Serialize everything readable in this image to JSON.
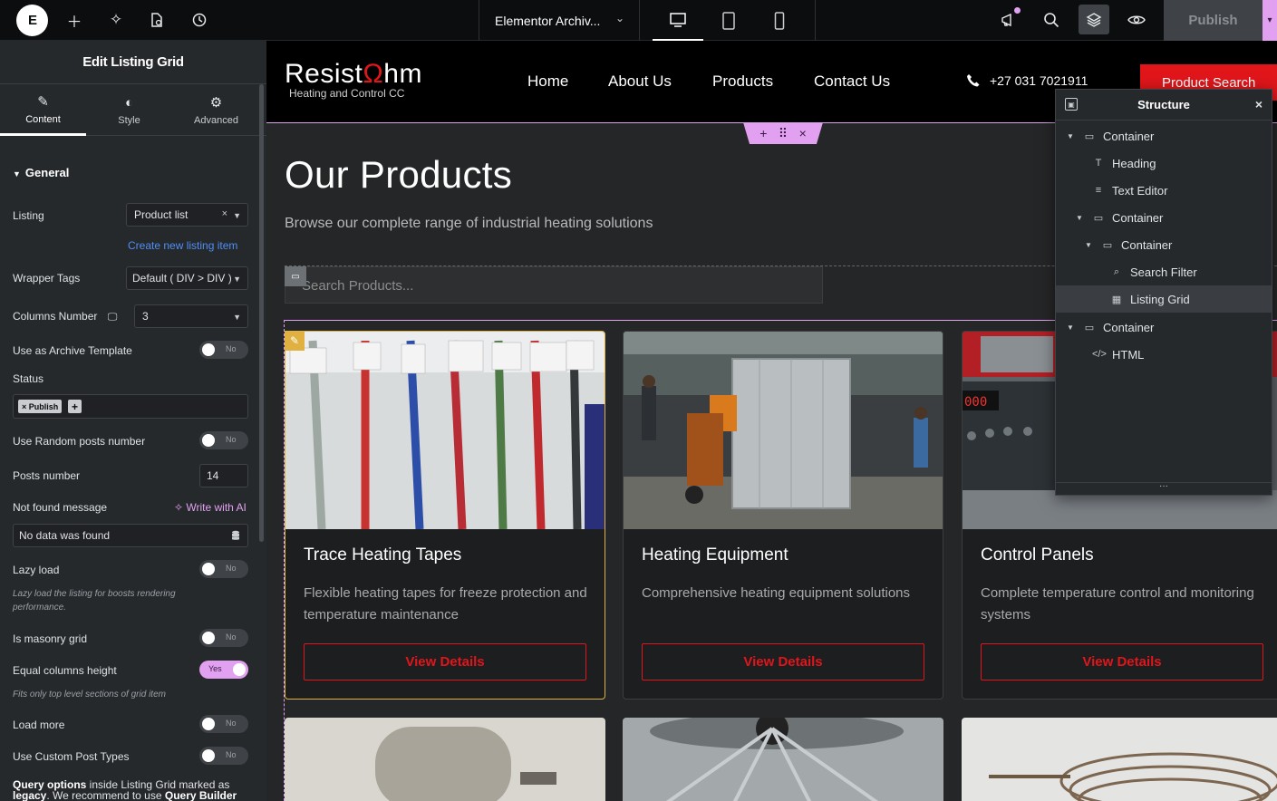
{
  "topbar": {
    "logo": "E",
    "document_title": "Elementor Archiv...",
    "publish_label": "Publish"
  },
  "panel": {
    "title": "Edit Listing Grid",
    "tabs": [
      {
        "label": "Content",
        "icon": "pencil-icon"
      },
      {
        "label": "Style",
        "icon": "half-circle-icon"
      },
      {
        "label": "Advanced",
        "icon": "gear-icon"
      }
    ],
    "section": "General",
    "listing_label": "Listing",
    "listing_value": "Product list",
    "create_link": "Create new listing item",
    "wrapper_label": "Wrapper Tags",
    "wrapper_value": "Default ( DIV > DIV )",
    "columns_label": "Columns Number",
    "columns_value": "3",
    "archive_label": "Use as Archive Template",
    "archive_value": "No",
    "status_label": "Status",
    "status_chip": "× Publish",
    "status_add": "+",
    "random_label": "Use Random posts number",
    "random_value": "No",
    "posts_label": "Posts number",
    "posts_value": "14",
    "notfound_label": "Not found message",
    "write_ai": "Write with AI",
    "notfound_value": "No data was found",
    "lazy_label": "Lazy load",
    "lazy_value": "No",
    "lazy_hint": "Lazy load the listing for boosts rendering performance.",
    "masonry_label": "Is masonry grid",
    "masonry_value": "No",
    "equal_label": "Equal columns height",
    "equal_value": "Yes",
    "equal_hint": "Fits only top level sections of grid item",
    "loadmore_label": "Load more",
    "loadmore_value": "No",
    "custom_label": "Use Custom Post Types",
    "custom_value": "No",
    "legacy_b1": "Query options",
    "legacy_t1": " inside Listing Grid marked as ",
    "legacy_b2": "legacy",
    "legacy_t2": ". We recommend to use ",
    "legacy_b3": "Query Builder"
  },
  "site": {
    "brand_main_a": "Resist",
    "brand_main_om": "Ω",
    "brand_main_b": "hm",
    "brand_sub": "Heating and Control CC",
    "nav": [
      "Home",
      "About Us",
      "Products",
      "Contact Us"
    ],
    "phone": "+27 031 7021911",
    "search_button": "Product Search",
    "heading": "Our Products",
    "subheading": "Browse our complete range of industrial heating solutions",
    "search_placeholder": "Search Products...",
    "cards": [
      {
        "title": "Trace Heating Tapes",
        "desc": "Flexible heating tapes for freeze protection and temperature maintenance",
        "button": "View Details"
      },
      {
        "title": "Heating Equipment",
        "desc": "Comprehensive heating equipment solutions",
        "button": "View Details"
      },
      {
        "title": "Control Panels",
        "desc": "Complete temperature control and monitoring systems",
        "button": "View Details"
      }
    ]
  },
  "structure": {
    "title": "Structure",
    "rows": [
      {
        "label": "Container",
        "icon": "container-icon"
      },
      {
        "label": "Heading",
        "icon": "heading-icon"
      },
      {
        "label": "Text Editor",
        "icon": "text-editor-icon"
      },
      {
        "label": "Container",
        "icon": "container-icon"
      },
      {
        "label": "Container",
        "icon": "container-icon"
      },
      {
        "label": "Search Filter",
        "icon": "search-filter-icon"
      },
      {
        "label": "Listing Grid",
        "icon": "listing-grid-icon"
      },
      {
        "label": "Container",
        "icon": "container-icon"
      },
      {
        "label": "HTML",
        "icon": "code-icon"
      }
    ]
  },
  "colors": {
    "accent_pink": "#e2a1f0",
    "brand_red": "#e0161b",
    "link_blue": "#4f8ef5"
  }
}
